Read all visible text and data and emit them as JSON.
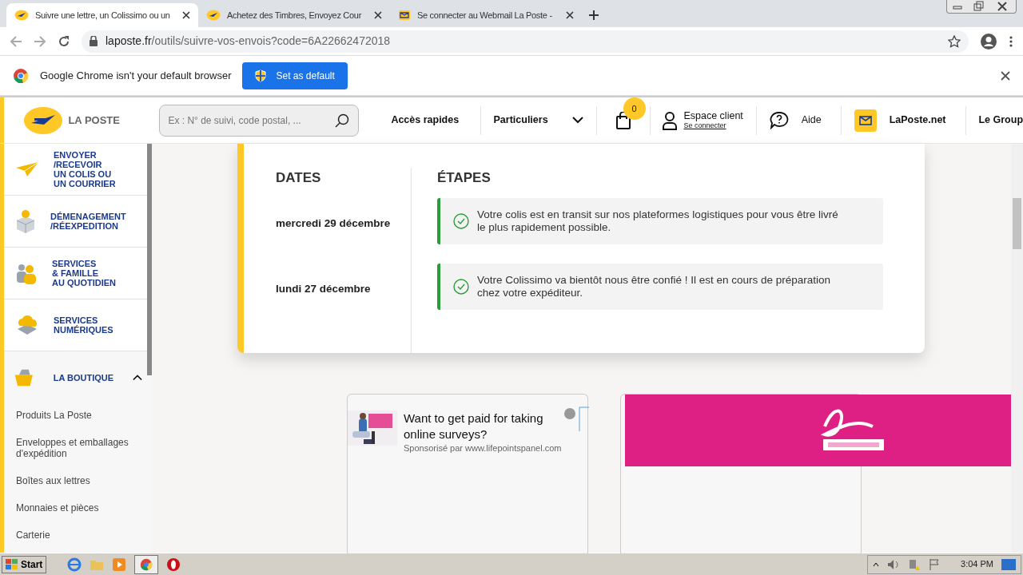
{
  "browser": {
    "tabs": [
      {
        "title": "Suivre une lettre, un Colissimo ou un",
        "selected": true,
        "kind": "poste"
      },
      {
        "title": "Achetez des Timbres, Envoyez Cour",
        "selected": false,
        "kind": "poste"
      },
      {
        "title": "Se connecter au Webmail La Poste -",
        "selected": false,
        "kind": "mail"
      }
    ],
    "address": {
      "domain": "laposte.fr",
      "path": "/outils/suivre-vos-envois?code=6A22662472018"
    },
    "infobar": {
      "message": "Google Chrome isn't your default browser",
      "button": "Set as default"
    }
  },
  "site": {
    "logo": "LA POSTE",
    "search": {
      "placeholder": "Ex : N° de suivi, code postal, ..."
    },
    "quick_access": "Accès rapides",
    "audience": "Particuliers",
    "cart_count": "0",
    "account": {
      "title": "Espace client",
      "link": "Se connecter"
    },
    "help": "Aide",
    "mail": "LaPoste.net",
    "group": "Le Group"
  },
  "sidebar": {
    "sections": [
      {
        "lines": [
          "ENVOYER",
          "/RECEVOIR",
          "UN COLIS OU",
          "UN COURRIER"
        ]
      },
      {
        "lines": [
          "DÉMENAGEMENT",
          "/RÉEXPEDITION"
        ]
      },
      {
        "lines": [
          "SERVICES",
          "& FAMILLE",
          "AU QUOTIDIEN"
        ]
      },
      {
        "lines": [
          "SERVICES",
          "NUMÉRIQUES"
        ]
      }
    ],
    "boutique": {
      "label": "LA BOUTIQUE",
      "expanded": true,
      "items": [
        {
          "lines": [
            "Produits La Poste"
          ]
        },
        {
          "lines": [
            "Enveloppes et emballages",
            "d'expédition"
          ]
        },
        {
          "lines": [
            "Boîtes aux lettres"
          ]
        },
        {
          "lines": [
            "Monnaies et pièces"
          ]
        },
        {
          "lines": [
            "Carterie"
          ]
        }
      ]
    }
  },
  "tracking": {
    "dates_heading": "DATES",
    "steps_heading": "ÉTAPES",
    "events": [
      {
        "date": "mercredi 29 décembre",
        "lines": [
          "Votre colis est en transit sur nos plateformes logistiques pour vous être livré",
          "le plus rapidement possible."
        ]
      },
      {
        "date": "lundi 27 décembre",
        "lines": [
          "Votre Colissimo va bientôt nous être confié ! Il est en cours de préparation",
          "chez votre expéditeur."
        ]
      }
    ]
  },
  "ad": {
    "headline": "Want to get paid for taking online surveys?",
    "sponsor": "Sponsorisé par www.lifepointspanel.com"
  },
  "taskbar": {
    "start": "Start",
    "clock": "3:04 PM"
  }
}
